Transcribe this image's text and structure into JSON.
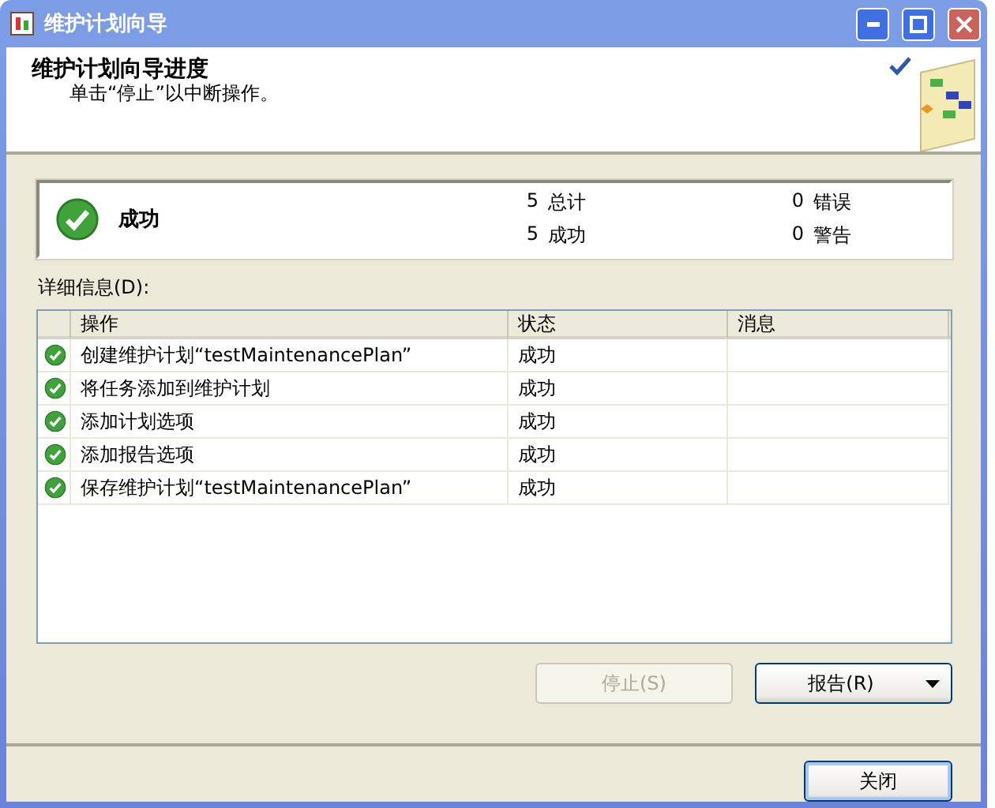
{
  "window": {
    "title": "维护计划向导"
  },
  "header": {
    "title": "维护计划向导进度",
    "subtitle": "单击“停止”以中断操作。"
  },
  "summary": {
    "status": "成功",
    "stats": [
      {
        "count": "5",
        "label": "总计"
      },
      {
        "count": "0",
        "label": "错误"
      },
      {
        "count": "5",
        "label": "成功"
      },
      {
        "count": "0",
        "label": "警告"
      }
    ]
  },
  "details_label": "详细信息(D):",
  "table": {
    "columns": [
      "操作",
      "状态",
      "消息"
    ],
    "rows": [
      {
        "operation": "创建维护计划“testMaintenancePlan”",
        "status": "成功"
      },
      {
        "operation": "将任务添加到维护计划",
        "status": "成功"
      },
      {
        "operation": "添加计划选项",
        "status": "成功"
      },
      {
        "operation": "添加报告选项",
        "status": "成功"
      },
      {
        "operation": "保存维护计划“testMaintenancePlan”",
        "status": "成功"
      }
    ]
  },
  "buttons": [
    {
      "kind": "plain",
      "label": "停止(S)",
      "disabled": true
    },
    {
      "kind": "dropdown",
      "label": "报告(R)",
      "disabled": false
    },
    {
      "kind": "default",
      "label": "关闭",
      "disabled": false
    }
  ]
}
